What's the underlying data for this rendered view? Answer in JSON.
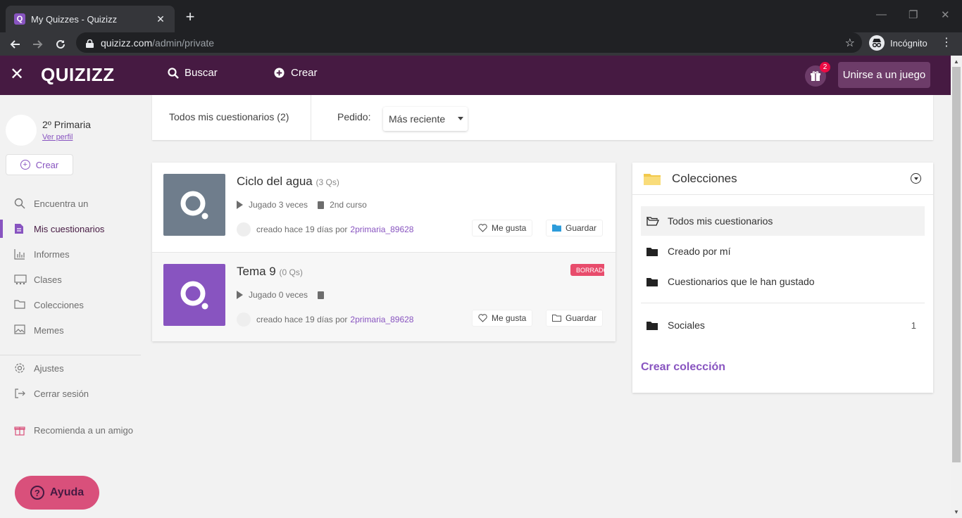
{
  "browser": {
    "tab_title": "My Quizzes - Quizizz",
    "url_host": "quizizz.com",
    "url_path": "/admin/private",
    "incognito_label": "Incógnito"
  },
  "header": {
    "logo": "QUIZIZZ",
    "search_label": "Buscar",
    "create_label": "Crear",
    "gift_badge": "2",
    "join_label": "Unirse a un juego",
    "bg_color": "#461a42",
    "accent_color": "#8854c0"
  },
  "sidebar": {
    "user_name": "2º Primaria",
    "profile_link": "Ver perfil",
    "create_label": "Crear",
    "items": [
      {
        "label": "Encuentra un",
        "icon": "search-icon"
      },
      {
        "label": "Mis cuestionarios",
        "icon": "document-icon"
      },
      {
        "label": "Informes",
        "icon": "chart-icon"
      },
      {
        "label": "Clases",
        "icon": "classes-icon"
      },
      {
        "label": "Colecciones",
        "icon": "folder-icon"
      },
      {
        "label": "Memes",
        "icon": "image-icon"
      },
      {
        "label": "Ajustes",
        "icon": "gear-icon"
      },
      {
        "label": "Cerrar sesión",
        "icon": "logout-icon"
      },
      {
        "label": "Recomienda a un amigo",
        "icon": "gift-icon"
      }
    ],
    "help_label": "Ayuda"
  },
  "filters": {
    "all_label": "Todos mis cuestionarios (2)",
    "order_label": "Pedido:",
    "order_value": "Más reciente"
  },
  "quizzes": [
    {
      "title": "Ciclo del agua",
      "count": "(3 Qs)",
      "played": "Jugado 3 veces",
      "grade": "2nd curso",
      "created": "creado hace 19 días por",
      "author": "2primaria_89628",
      "like_label": "Me gusta",
      "save_label": "Guardar",
      "thumb_color": "#6f7d8c"
    },
    {
      "title": "Tema 9",
      "count": "(0 Qs)",
      "played": "Jugado 0 veces",
      "grade": "",
      "created": "creado hace 19 días por",
      "author": "2primaria_89628",
      "like_label": "Me gusta",
      "save_label": "Guardar",
      "draft_badge": "BORRADOR",
      "thumb_color": "#8854c0"
    }
  ],
  "collections": {
    "title": "Colecciones",
    "items": [
      {
        "label": "Todos mis cuestionarios"
      },
      {
        "label": "Creado por mí"
      },
      {
        "label": "Cuestionarios que le han gustado"
      },
      {
        "label": "Sociales",
        "count": "1"
      }
    ],
    "create_label": "Crear colección"
  }
}
